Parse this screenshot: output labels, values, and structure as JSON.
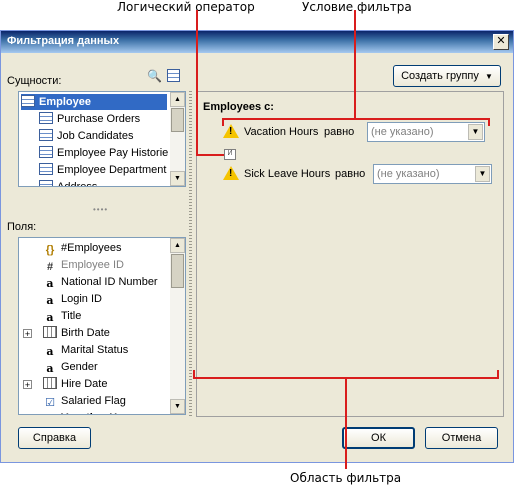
{
  "callouts": {
    "logical_operator": "Логический оператор",
    "filter_condition": "Условие фильтра",
    "filter_area": "Область фильтра"
  },
  "dialog": {
    "title": "Фильтрация данных",
    "close_glyph": "✕",
    "entities_label": "Сущности:",
    "entities": [
      {
        "label": "Employee",
        "bold": true,
        "icon": "entity-icon"
      },
      {
        "label": "Purchase Orders",
        "icon": "related-entity-icon"
      },
      {
        "label": "Job Candidates",
        "icon": "related-entity-icon"
      },
      {
        "label": "Employee Pay Historie",
        "icon": "related-entity-icon"
      },
      {
        "label": "Employee Department",
        "icon": "related-entity-icon"
      },
      {
        "label": "Address",
        "icon": "related-entity-icon"
      }
    ],
    "fields_label": "Поля:",
    "fields": [
      {
        "label": "#Employees",
        "icon": "expression-icon"
      },
      {
        "label": "Employee ID",
        "icon": "number-icon",
        "grey": true
      },
      {
        "label": "National ID Number",
        "icon": "text-icon"
      },
      {
        "label": "Login ID",
        "icon": "text-icon"
      },
      {
        "label": "Title",
        "icon": "text-icon"
      },
      {
        "label": "Birth Date",
        "icon": "date-icon",
        "expandable": true
      },
      {
        "label": "Marital Status",
        "icon": "text-icon"
      },
      {
        "label": "Gender",
        "icon": "text-icon"
      },
      {
        "label": "Hire Date",
        "icon": "date-icon",
        "expandable": true
      },
      {
        "label": "Salaried Flag",
        "icon": "boolean-icon"
      },
      {
        "label": "Vacation Hours",
        "icon": "number-icon",
        "bold": true,
        "expandable": true
      }
    ],
    "add_group_button": "Создать группу",
    "filter_header": "Employees с:",
    "conditions": [
      {
        "field": "Vacation Hours",
        "operator": "равно",
        "value_placeholder": "(не указано)"
      },
      {
        "field": "Sick Leave Hours",
        "operator": "равно",
        "value_placeholder": "(не указано)"
      }
    ],
    "logical_operator_glyph": "И",
    "help_button": "Справка",
    "ok_button": "ОК",
    "cancel_button": "Отмена"
  }
}
